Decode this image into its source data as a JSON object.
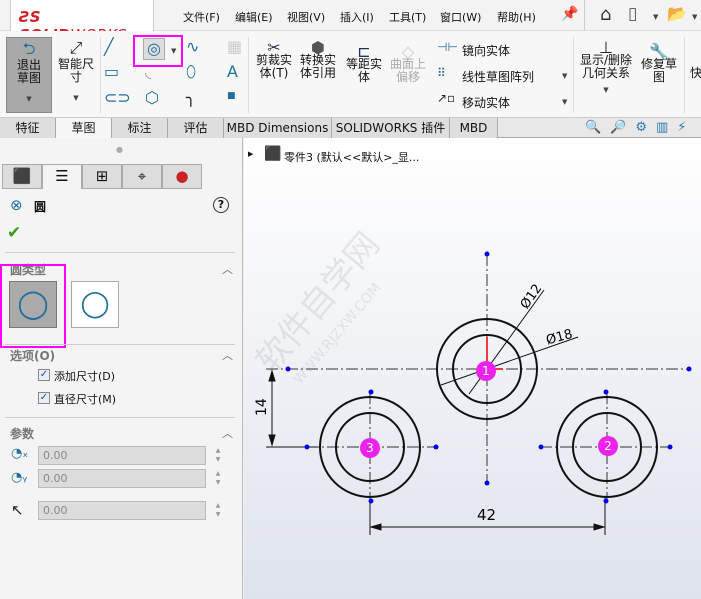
{
  "app": {
    "logo_brand": "SOLIDWORKS"
  },
  "menu": [
    "文件(F)",
    "编辑(E)",
    "视图(V)",
    "插入(I)",
    "工具(T)",
    "窗口(W)",
    "帮助(H)"
  ],
  "toolbar": {
    "exit_sketch": "退出草图",
    "smart_dim": "智能尺寸",
    "trim": "剪裁实体(T)",
    "convert": "转换实体引用",
    "offset": "等距实体",
    "surface_offset": "曲面上偏移",
    "mirror": "镜向实体",
    "linear_pattern": "线性草图阵列",
    "move": "移动实体",
    "relations": "显示/删除几何关系",
    "repair": "修复草图",
    "quick": "快"
  },
  "tabs": [
    "特征",
    "草图",
    "标注",
    "评估",
    "MBD Dimensions",
    "SOLIDWORKS 插件",
    "MBD"
  ],
  "panel": {
    "title": "圆",
    "circle_type_label": "圆类型",
    "options_label": "选项(O)",
    "add_dim": "添加尺寸(D)",
    "diameter_dim": "直径尺寸(M)",
    "params_label": "参数",
    "x": "0.00",
    "y": "0.00",
    "r": "0.00",
    "help": "?"
  },
  "canvas": {
    "tree_label": "零件3 (默认<<默认>_显...",
    "dim_phi12": "Ø12",
    "dim_phi18": "Ø18",
    "dim_14": "14",
    "dim_42": "42",
    "marker1": "1",
    "marker2": "2",
    "marker3": "3",
    "watermark": "软件自学网",
    "watermark_url": "WWW.RJZXW.COM"
  }
}
